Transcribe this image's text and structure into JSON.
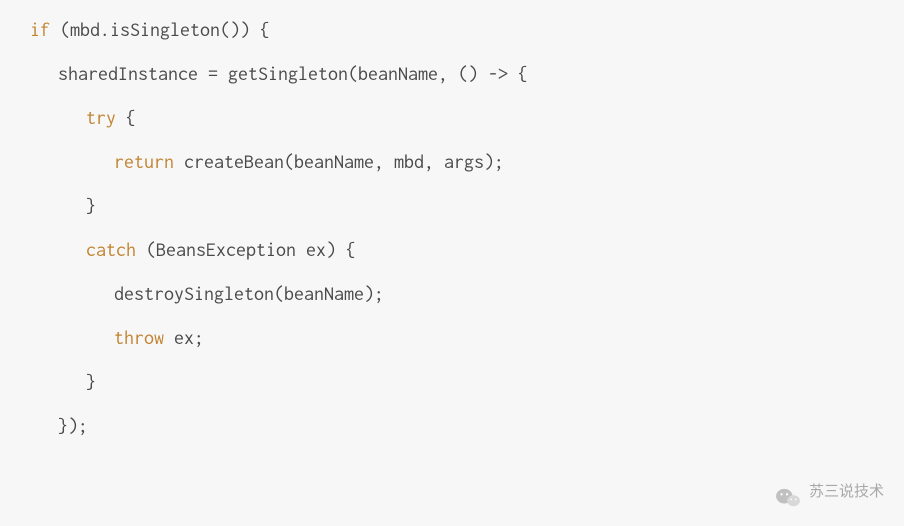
{
  "code": {
    "lines": [
      {
        "kw1": "if",
        "plain": " (mbd.isSingleton()) {"
      },
      {
        "plain": "sharedInstance = getSingleton(beanName, () -> {"
      },
      {
        "kw1": "try",
        "plain": " {"
      },
      {
        "kw1": "return",
        "plain": " createBean(beanName, mbd, args);"
      },
      {
        "plain": "}"
      },
      {
        "kw1": "catch",
        "plain": " (BeansException ex) {"
      },
      {
        "plain": "destroySingleton(beanName);"
      },
      {
        "kw1": "throw",
        "plain": " ex;"
      },
      {
        "plain": "}"
      },
      {
        "plain": "});"
      }
    ]
  },
  "watermark": {
    "text": "苏三说技术"
  }
}
